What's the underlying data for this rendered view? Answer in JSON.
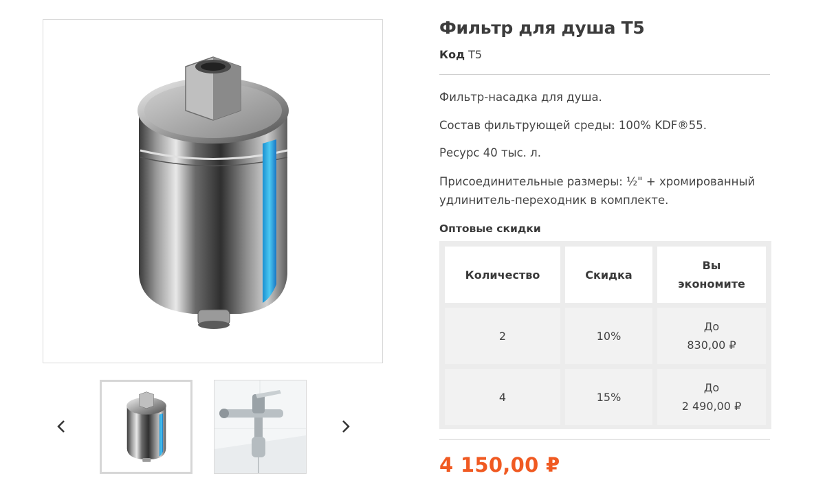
{
  "product": {
    "title": "Фильтр для душа Т5",
    "code_label": "Код",
    "code_value": "T5",
    "description": [
      "Фильтр-насадка для душа.",
      "Состав фильтрующей среды: 100% KDF®55.",
      "Ресурс 40 тыс. л.",
      "Присоединительные размеры: ½\" + хромированный удлинитель-переходник в комплекте."
    ],
    "price": "4 150,00 ₽"
  },
  "discounts": {
    "heading": "Оптовые скидки",
    "columns": [
      "Количество",
      "Скидка",
      "Вы экономите"
    ],
    "rows": [
      {
        "quantity": "2",
        "discount": "10%",
        "save_prefix": "До",
        "save_amount": "830,00 ₽"
      },
      {
        "quantity": "4",
        "discount": "15%",
        "save_prefix": "До",
        "save_amount": "2 490,00 ₽"
      }
    ]
  },
  "gallery": {
    "prev_icon": "chevron-left-icon",
    "next_icon": "chevron-right-icon",
    "accent_color": "#f05a22",
    "filter_stripe_color": "#2fb6e8"
  }
}
